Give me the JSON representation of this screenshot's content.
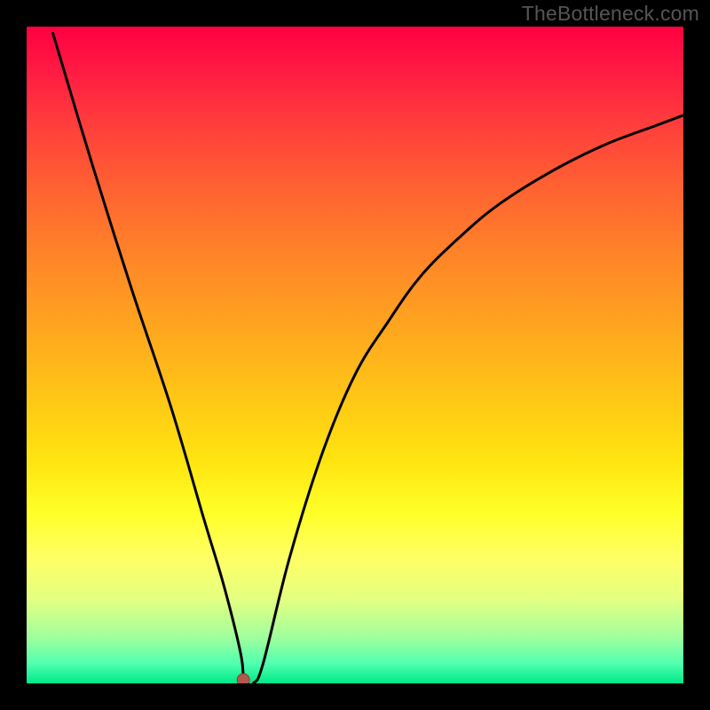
{
  "watermark": "TheBottleneck.com",
  "chart_data": {
    "type": "line",
    "title": "",
    "xlabel": "",
    "ylabel": "",
    "xlim": [
      0,
      100
    ],
    "ylim": [
      0,
      100
    ],
    "series": [
      {
        "name": "curve",
        "x": [
          4,
          10,
          16,
          22,
          27,
          30,
          32.5,
          33,
          33,
          33.5,
          34.5,
          36,
          40,
          45,
          50,
          55,
          60,
          66,
          72,
          80,
          88,
          96,
          100
        ],
        "values": [
          99,
          79,
          60,
          42,
          25,
          15,
          5,
          1,
          0,
          0,
          0,
          3,
          19,
          35,
          47,
          55,
          62,
          68,
          73,
          78,
          82,
          85,
          86.5
        ]
      }
    ],
    "marker": {
      "x": 33,
      "y": 0
    },
    "gradient_colors": {
      "top": "#ff0040",
      "mid_upper": "#ff8a28",
      "mid_lower": "#ffe814",
      "bottom": "#00e887"
    }
  }
}
